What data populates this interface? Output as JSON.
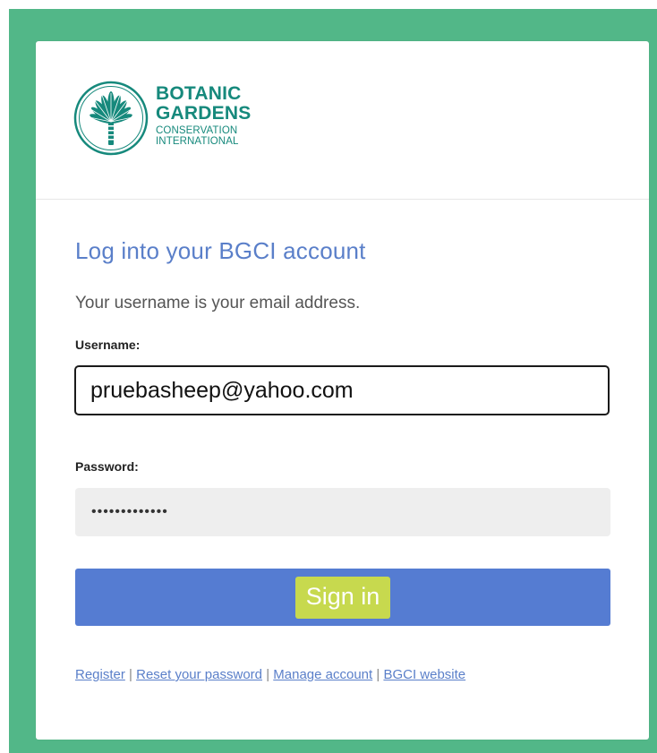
{
  "logo": {
    "line1": "BOTANIC",
    "line2": "GARDENS",
    "line3": "CONSERVATION",
    "line4": "INTERNATIONAL",
    "brand_color": "#16897c",
    "icon": "botanic-palm-emblem-icon"
  },
  "form": {
    "title": "Log into your BGCI account",
    "hint": "Your username is your email address.",
    "username_label": "Username:",
    "username_value": "pruebasheep@yahoo.com",
    "password_label": "Password:",
    "password_value": "•••••••••••••",
    "signin_label": "Sign in"
  },
  "links": {
    "register": "Register",
    "reset": "Reset your password",
    "manage": "Manage account",
    "website": "BGCI website",
    "separator": "|"
  },
  "colors": {
    "background": "#52b788",
    "title": "#5a7fc9",
    "button": "#557cd2",
    "highlight": "#c7d94e"
  }
}
